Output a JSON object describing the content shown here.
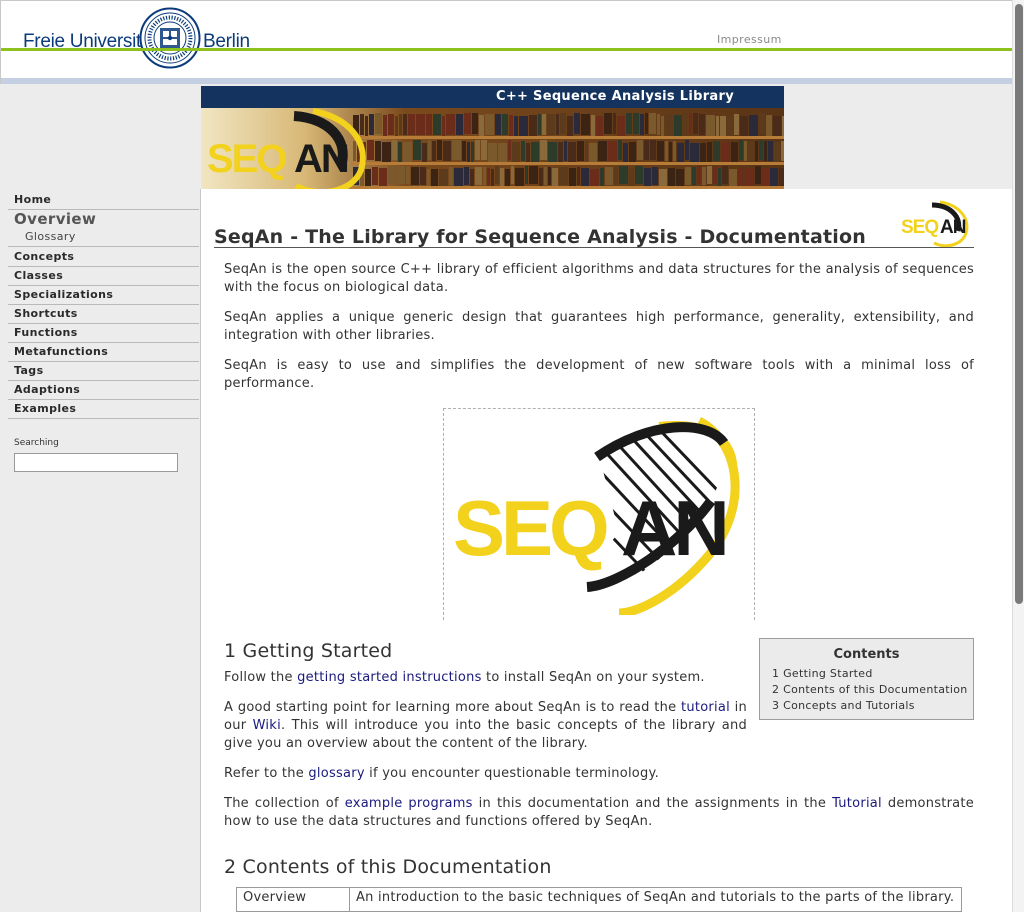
{
  "header": {
    "university_left": "Freie Universität",
    "university_right": "Berlin",
    "impressum": "Impressum"
  },
  "banner": {
    "title": "C++ Sequence Analysis Library",
    "logo_text_yellow": "SEQ",
    "logo_text_black": "AN"
  },
  "sidebar": {
    "items": [
      {
        "label": "Home"
      },
      {
        "label": "Overview"
      },
      {
        "label": "Glossary"
      },
      {
        "label": "Concepts"
      },
      {
        "label": "Classes"
      },
      {
        "label": "Specializations"
      },
      {
        "label": "Shortcuts"
      },
      {
        "label": "Functions"
      },
      {
        "label": "Metafunctions"
      },
      {
        "label": "Tags"
      },
      {
        "label": "Adaptions"
      },
      {
        "label": "Examples"
      }
    ],
    "search_label": "Searching",
    "search_value": ""
  },
  "main": {
    "title": "SeqAn - The Library for Sequence Analysis - Documentation",
    "intro": [
      "SeqAn is the open source C++ library of efficient algorithms and data structures for the analysis of sequences with the focus on biological data.",
      "SeqAn applies a unique generic design that guarantees high performance, generality, extensibility, and integration with other libraries.",
      "SeqAn is easy to use and simplifies the development of new software tools with a minimal loss of performance."
    ],
    "section1": {
      "heading": "1 Getting Started",
      "p1_before": "Follow the ",
      "p1_link": "getting started instructions",
      "p1_after": " to install SeqAn on your system.",
      "p2_before": "A good starting point for learning more about SeqAn is to read the ",
      "p2_link1": "tutorial",
      "p2_mid": " in our ",
      "p2_link2": "Wiki",
      "p2_after": ". This will introduce you into the basic concepts of the library and give you an overview about the content of the library.",
      "p3_before": "Refer to the ",
      "p3_link": "glossary",
      "p3_after": " if you encounter questionable terminology.",
      "p4_before": "The collection of ",
      "p4_link1": "example programs",
      "p4_mid": " in this documentation and the assignments in the ",
      "p4_link2": "Tutorial",
      "p4_after": " demonstrate how to use the data structures and functions offered by SeqAn."
    },
    "toc": {
      "title": "Contents",
      "items": [
        "1 Getting Started",
        "2 Contents of this Documentation",
        "3 Concepts and Tutorials"
      ]
    },
    "section2": {
      "heading": "2 Contents of this Documentation",
      "table": [
        {
          "name": "Overview",
          "description": "An introduction to the basic techniques of SeqAn and tutorials to the parts of the library."
        }
      ]
    }
  },
  "colors": {
    "fu_blue": "#0b3b7a",
    "fu_green": "#8ec11e",
    "banner_bar": "#14345f",
    "seqan_yellow": "#f2d21c",
    "link": "#1a1a7e"
  }
}
